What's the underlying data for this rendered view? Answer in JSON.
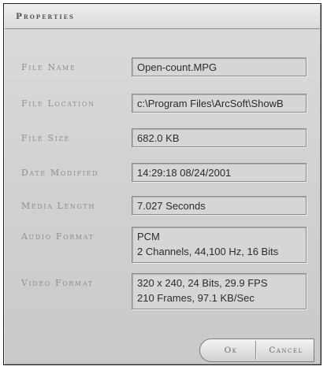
{
  "dialog": {
    "title": "Properties"
  },
  "fields": [
    {
      "label": "File Name",
      "lines": [
        "Open-count.MPG"
      ]
    },
    {
      "label": "File Location",
      "lines": [
        "c:\\Program Files\\ArcSoft\\ShowB"
      ]
    },
    {
      "label": "File Size",
      "lines": [
        "682.0 KB"
      ]
    },
    {
      "label": "Date Modified",
      "lines": [
        "14:29:18  08/24/2001"
      ]
    },
    {
      "label": "Media Length",
      "lines": [
        "7.027 Seconds"
      ]
    },
    {
      "label": "Audio Format",
      "lines": [
        "PCM",
        "2 Channels, 44,100 Hz, 16 Bits"
      ]
    },
    {
      "label": "Video Format",
      "lines": [
        "320 x 240, 24 Bits, 29.9 FPS",
        "210 Frames, 97.1 KB/Sec"
      ]
    }
  ],
  "buttons": {
    "ok": "Ok",
    "cancel": "Cancel"
  }
}
